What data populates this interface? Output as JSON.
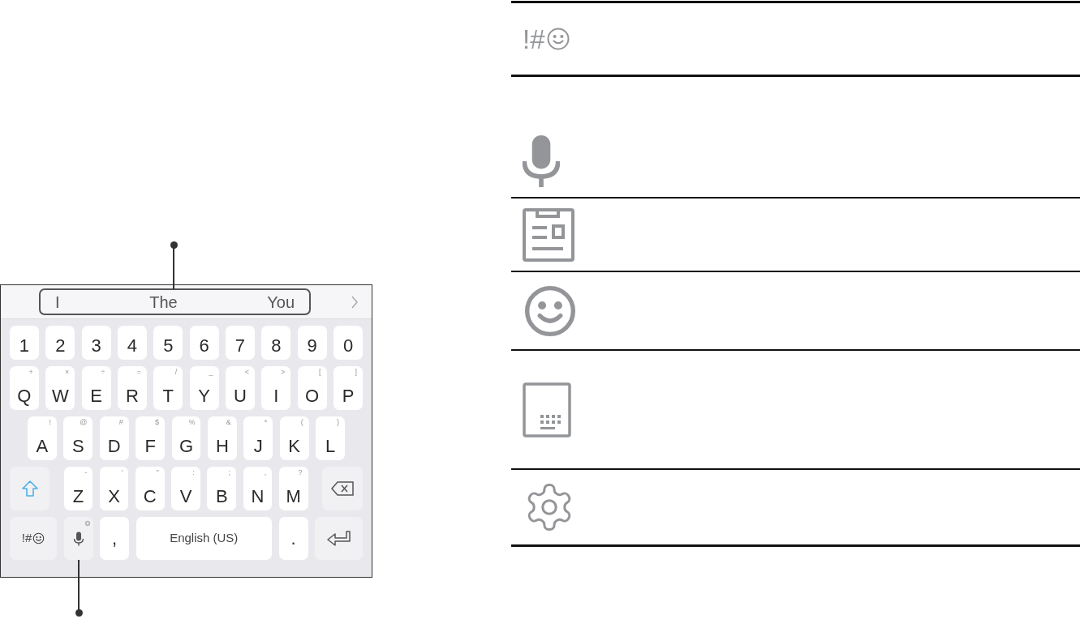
{
  "keyboard": {
    "suggestions": [
      "I",
      "The",
      "You"
    ],
    "rows": [
      [
        {
          "label": "1"
        },
        {
          "label": "2"
        },
        {
          "label": "3"
        },
        {
          "label": "4"
        },
        {
          "label": "5"
        },
        {
          "label": "6"
        },
        {
          "label": "7"
        },
        {
          "label": "8"
        },
        {
          "label": "9"
        },
        {
          "label": "0"
        }
      ],
      [
        {
          "label": "Q",
          "sub": "+"
        },
        {
          "label": "W",
          "sub": "×"
        },
        {
          "label": "E",
          "sub": "÷"
        },
        {
          "label": "R",
          "sub": "="
        },
        {
          "label": "T",
          "sub": "/"
        },
        {
          "label": "Y",
          "sub": "_"
        },
        {
          "label": "U",
          "sub": "<"
        },
        {
          "label": "I",
          "sub": ">"
        },
        {
          "label": "O",
          "sub": "["
        },
        {
          "label": "P",
          "sub": "]"
        }
      ],
      [
        {
          "label": "A",
          "sub": "!"
        },
        {
          "label": "S",
          "sub": "@"
        },
        {
          "label": "D",
          "sub": "#"
        },
        {
          "label": "F",
          "sub": "$"
        },
        {
          "label": "G",
          "sub": "%"
        },
        {
          "label": "H",
          "sub": "&"
        },
        {
          "label": "J",
          "sub": "*"
        },
        {
          "label": "K",
          "sub": "("
        },
        {
          "label": "L",
          "sub": ")"
        }
      ],
      [
        {
          "label": "Z",
          "sub": "-"
        },
        {
          "label": "X",
          "sub": "'"
        },
        {
          "label": "C",
          "sub": "\""
        },
        {
          "label": "V",
          "sub": ":"
        },
        {
          "label": "B",
          "sub": ";"
        },
        {
          "label": "N",
          "sub": ","
        },
        {
          "label": "M",
          "sub": "?"
        }
      ]
    ],
    "symbols_key": "!#",
    "comma_key": ",",
    "space_key": "English (US)",
    "period_key": "."
  },
  "icon_table": [
    {
      "kind": "symbols",
      "text": "!#"
    },
    {
      "kind": "mic"
    },
    {
      "kind": "clipboard"
    },
    {
      "kind": "emoji"
    },
    {
      "kind": "keyboard-mode"
    },
    {
      "kind": "settings"
    }
  ]
}
